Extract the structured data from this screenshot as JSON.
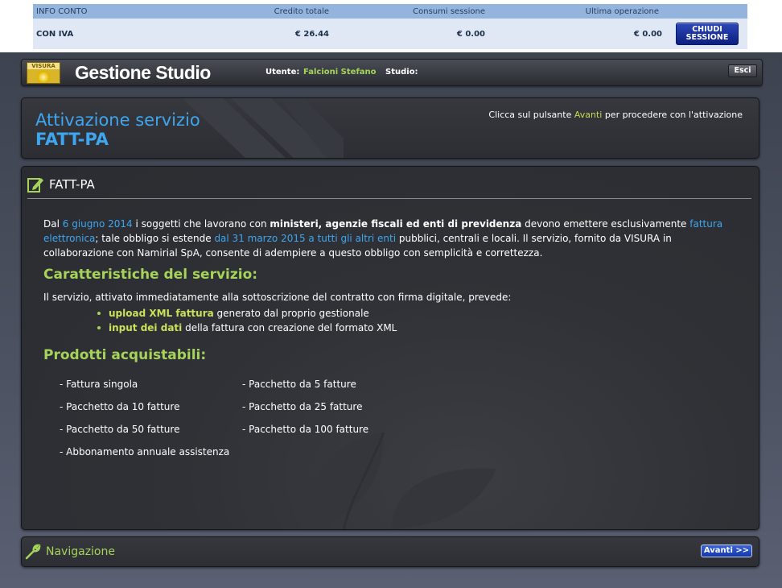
{
  "account": {
    "headers": [
      "INFO CONTO",
      "Credito totale",
      "Consumi sessione",
      "Ultima operazione"
    ],
    "row_label": "CON IVA",
    "credito": "€  26.44",
    "consumi": "€ 0.00",
    "ultima": "€ 0.00",
    "close_label": "CHIUDI\nSESSIONE"
  },
  "header": {
    "logo_text": "VISURA",
    "title": "Gestione Studio",
    "user_label": "Utente:",
    "user_value": "Falcioni Stefano",
    "studio_label": "Studio:",
    "esci_label": "Esci"
  },
  "activation": {
    "title": "Attivazione servizio",
    "subtitle": "FATT-PA",
    "hint_pre": "Clicca sul pulsante ",
    "hint_hl": "Avanti",
    "hint_post": " per procedere con l'attivazione"
  },
  "content": {
    "section_title": "FATT-PA",
    "intro": {
      "p1": "Dal ",
      "date1": "6 giugno 2014",
      "p2": " i soggetti che lavorano con ",
      "bold1": "ministeri, agenzie fiscali ed enti di previdenza",
      "p3": " devono emettere esclusivamente ",
      "link1": "fattura elettronica",
      "p4": "; tale obbligo si estende ",
      "link2": "dal 31 marzo 2015 a tutti gli altri enti",
      "p5": " pubblici, centrali e locali. Il servizio, fornito da VISURA in collaborazione con Namirial SpA, consente di adempiere a questo obbligo con semplicità e correttezza."
    },
    "features_title": "Caratteristiche del servizio:",
    "features_intro": "Il servizio, attivato immediatamente alla sottoscrizione del contratto con firma digitale, prevede:",
    "features": [
      {
        "em": "upload XML fattura",
        "rest": " generato dal proprio gestionale"
      },
      {
        "em": "input dei dati",
        "rest": " della fattura con creazione del formato XML"
      }
    ],
    "products_title": "Prodotti acquistabili:",
    "products": [
      "- Fattura singola",
      "- Pacchetto da 5 fatture",
      "- Pacchetto da 10 fatture",
      "- Pacchetto da 25 fatture",
      "- Pacchetto da 50 fatture",
      "- Pacchetto da 100 fatture",
      "- Abbonamento annuale assistenza"
    ]
  },
  "nav": {
    "title": "Navigazione",
    "next_label": "Avanti >>"
  },
  "colors": {
    "accent_blue": "#3ea6ee",
    "accent_green": "#a6d35a",
    "panel_bg": "#2c2e33"
  }
}
